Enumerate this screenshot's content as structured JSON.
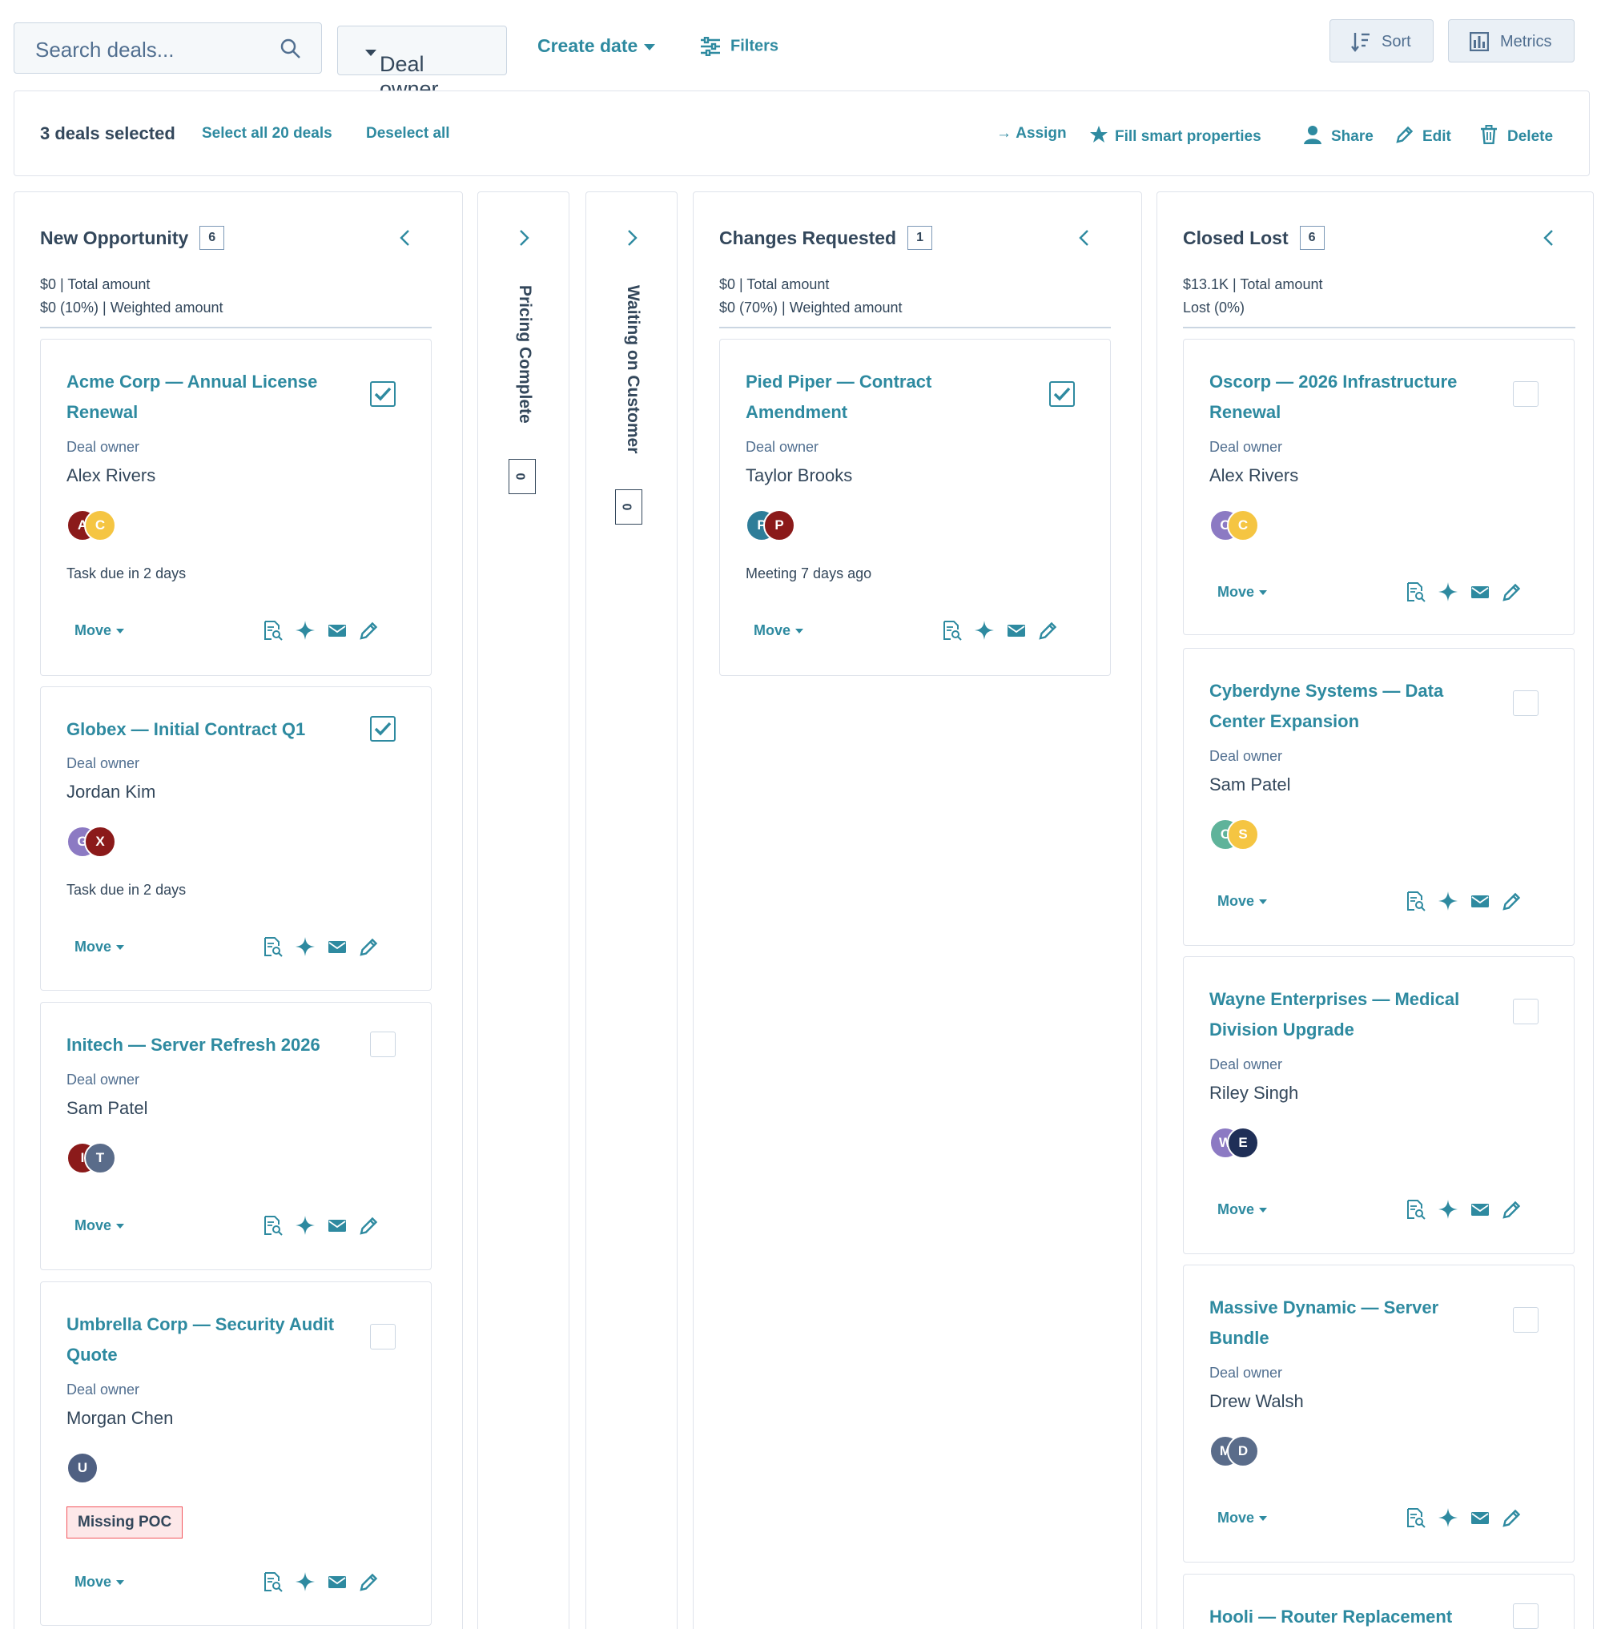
{
  "toolbar": {
    "search_placeholder": "Search deals...",
    "deal_owner": "Deal owner",
    "create_date": "Create date",
    "filters": "Filters",
    "sort": "Sort",
    "metrics": "Metrics"
  },
  "bulk": {
    "selected": "3 deals selected",
    "select_all": "Select all 20 deals",
    "deselect_all": "Deselect all",
    "assign": "Assign",
    "fill_smart": "Fill smart properties",
    "share": "Share",
    "edit": "Edit",
    "delete": "Delete"
  },
  "colors": {
    "accent": "#0091ae",
    "card_title": "#2e8aa0",
    "text": "#33475b",
    "border": "#dfe3eb",
    "tag_bg": "#fde8e9",
    "tag_border": "#f2545b"
  },
  "columns": [
    {
      "name": "New Opportunity",
      "count": "6",
      "total": "$0 | Total amount",
      "weighted": "$0 (10%) | Weighted amount",
      "cards": [
        {
          "title": "Acme Corp — Annual License Renewal",
          "owner_label": "Deal owner",
          "owner": "Alex Rivers",
          "activity": "Task due in 2 days",
          "move": "Move",
          "checked": true,
          "avatars": [
            "A",
            "C"
          ]
        },
        {
          "title": "Globex — Initial Contract Q1",
          "owner_label": "Deal owner",
          "owner": "Jordan Kim",
          "activity": "Task due in 2 days",
          "move": "Move",
          "checked": true,
          "avatars": [
            "G",
            "X"
          ]
        },
        {
          "title": "Initech — Server Refresh 2026",
          "owner_label": "Deal owner",
          "owner": "Sam Patel",
          "activity": "",
          "move": "Move",
          "checked": false,
          "avatars": [
            "I",
            "T"
          ]
        },
        {
          "title": "Umbrella Corp — Security Audit Quote",
          "owner_label": "Deal owner",
          "owner": "Morgan Chen",
          "tag": "Missing POC",
          "move": "Move",
          "checked": false,
          "avatars": [
            "U"
          ]
        }
      ]
    },
    {
      "name": "Pricing Complete",
      "count": "0",
      "collapsed": true
    },
    {
      "name": "Waiting on Customer",
      "count": "0",
      "collapsed": true
    },
    {
      "name": "Changes Requested",
      "count": "1",
      "total": "$0 | Total amount",
      "weighted": "$0 (70%) | Weighted amount",
      "cards": [
        {
          "title": "Pied Piper — Contract Amendment",
          "owner_label": "Deal owner",
          "owner": "Taylor Brooks",
          "activity": "Meeting 7 days ago",
          "move": "Move",
          "checked": true,
          "avatars": [
            "P",
            "P"
          ]
        }
      ]
    },
    {
      "name": "Closed Lost",
      "count": "6",
      "total": "$13.1K | Total amount",
      "weighted": "Lost (0%)",
      "cards": [
        {
          "title": "Oscorp — 2026 Infrastructure Renewal",
          "owner_label": "Deal owner",
          "owner": "Alex Rivers",
          "move": "Move",
          "checked": false,
          "avatars": [
            "O",
            "C"
          ]
        },
        {
          "title": "Cyberdyne Systems — Data Center Expansion",
          "owner_label": "Deal owner",
          "owner": "Sam Patel",
          "move": "Move",
          "checked": false,
          "avatars": [
            "C",
            "S"
          ]
        },
        {
          "title": "Wayne Enterprises — Medical Division Upgrade",
          "owner_label": "Deal owner",
          "owner": "Riley Singh",
          "move": "Move",
          "checked": false,
          "avatars": [
            "W",
            "E"
          ]
        },
        {
          "title": "Massive Dynamic — Server Bundle",
          "owner_label": "Deal owner",
          "owner": "Drew Walsh",
          "move": "Move",
          "checked": false,
          "avatars": [
            "M",
            "D"
          ]
        },
        {
          "title": "Hooli — Router Replacement",
          "checked": false
        }
      ]
    }
  ]
}
